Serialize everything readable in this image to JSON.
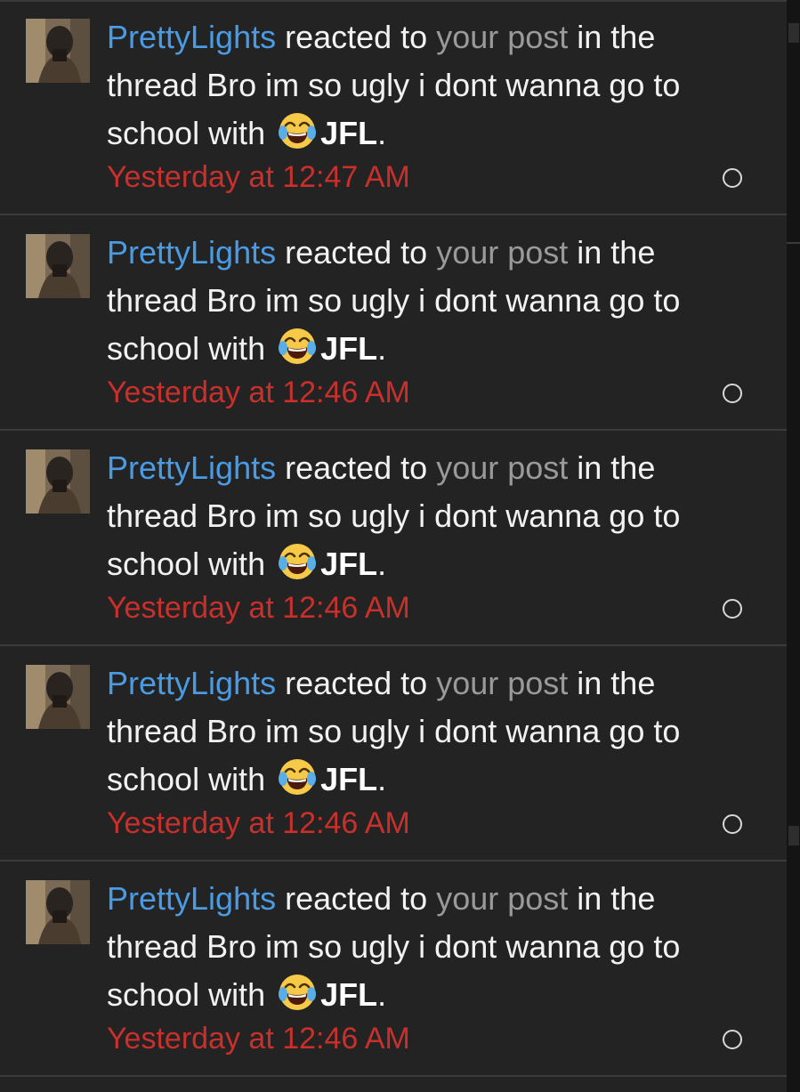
{
  "notifications": [
    {
      "username": "PrettyLights",
      "action": " reacted to ",
      "post_link": "your post",
      "middle": " in the thread Bro im so ugly i dont wanna go to school with ",
      "emoji": "face-with-tears-of-joy",
      "reaction": "JFL",
      "end": ".",
      "time": "Yesterday at 12:47 AM"
    },
    {
      "username": "PrettyLights",
      "action": " reacted to ",
      "post_link": "your post",
      "middle": " in the thread Bro im so ugly i dont wanna go to school with ",
      "emoji": "face-with-tears-of-joy",
      "reaction": "JFL",
      "end": ".",
      "time": "Yesterday at 12:46 AM"
    },
    {
      "username": "PrettyLights",
      "action": " reacted to ",
      "post_link": "your post",
      "middle": " in the thread Bro im so ugly i dont wanna go to school with ",
      "emoji": "face-with-tears-of-joy",
      "reaction": "JFL",
      "end": ".",
      "time": "Yesterday at 12:46 AM"
    },
    {
      "username": "PrettyLights",
      "action": " reacted to ",
      "post_link": "your post",
      "middle": " in the thread Bro im so ugly i dont wanna go to school with ",
      "emoji": "face-with-tears-of-joy",
      "reaction": "JFL",
      "end": ".",
      "time": "Yesterday at 12:46 AM"
    },
    {
      "username": "PrettyLights",
      "action": " reacted to ",
      "post_link": "your post",
      "middle": " in the thread Bro im so ugly i dont wanna go to school with ",
      "emoji": "face-with-tears-of-joy",
      "reaction": "JFL",
      "end": ".",
      "time": "Yesterday at 12:46 AM"
    }
  ],
  "colors": {
    "background": "#232323",
    "username": "#4a9be3",
    "link": "#9a9a9a",
    "body_text": "#f2f2f2",
    "time": "#c9302c",
    "divider": "#3b3b3b"
  }
}
